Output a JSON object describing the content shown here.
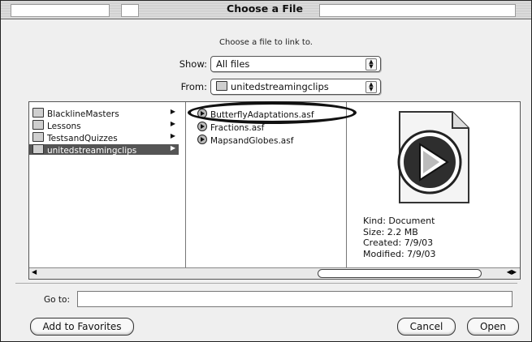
{
  "window": {
    "title": "Choose a File"
  },
  "prompt": "Choose a file to link to.",
  "show": {
    "label": "Show:",
    "value": "All files"
  },
  "from": {
    "label": "From:",
    "value": "unitedstreamingclips"
  },
  "column1": [
    {
      "name": "BlacklineMasters",
      "has_children": true
    },
    {
      "name": "Lessons",
      "has_children": true
    },
    {
      "name": "TestsandQuizzes",
      "has_children": true
    },
    {
      "name": "unitedstreamingclips",
      "has_children": true,
      "selected": true
    }
  ],
  "column2": [
    {
      "name": "ButterflyAdaptations.asf",
      "highlighted": true
    },
    {
      "name": "Fractions.asf"
    },
    {
      "name": "MapsandGlobes.asf"
    }
  ],
  "preview": {
    "kind": "Kind: Document",
    "size": "Size: 2.2 MB",
    "created": "Created: 7/9/03",
    "modified": "Modified: 7/9/03"
  },
  "goto": {
    "label": "Go to:",
    "value": ""
  },
  "buttons": {
    "add_favorites": "Add to Favorites",
    "cancel": "Cancel",
    "open": "Open"
  }
}
